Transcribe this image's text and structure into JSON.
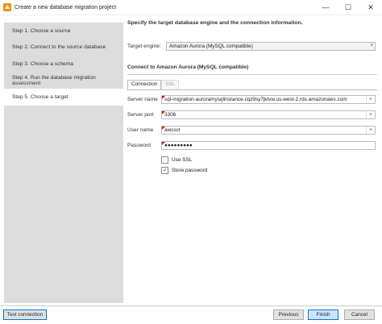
{
  "window": {
    "title": "Create a new database migration project",
    "minimize": "—",
    "maximize": "☐",
    "close": "✕"
  },
  "steps": [
    {
      "label": "Step 1. Choose a source"
    },
    {
      "label": "Step 2. Connect to the source database"
    },
    {
      "label": "Step 3. Choose a schema"
    },
    {
      "label": "Step 4. Run the database migration assessment"
    },
    {
      "label": "Step 5. Choose a target"
    }
  ],
  "main": {
    "heading": "Specify the target database engine and the connection information.",
    "target_engine_label": "Target engine:",
    "target_engine_value": "Amazon Aurora (MySQL compatible)",
    "section_title": "Connect to Amazon Aurora (MySQL compatible)",
    "tabs": [
      {
        "label": "Connection"
      },
      {
        "label": "SSL"
      }
    ],
    "fields": {
      "server_name_label": "Server name",
      "server_name_value": "sql-migration-auroramysqlinstance.cqz9sy7jktvw.us-west-2.rds.amazonaws.com",
      "server_port_label": "Server port",
      "server_port_value": "3306",
      "user_name_label": "User name",
      "user_name_value": "awssct",
      "password_label": "Password",
      "password_value": "●●●●●●●●●"
    },
    "use_ssl_label": "Use SSL",
    "store_password_label": "Store password"
  },
  "buttons": {
    "test_connection": "Test connection",
    "previous": "Previous",
    "finish": "Finish",
    "cancel": "Cancel"
  },
  "icons": {
    "dropdown": "˅",
    "check": "✓"
  },
  "colors": {
    "accent": "#0078d7",
    "required": "#dd1111",
    "steps_bg": "#dcdcdc"
  }
}
